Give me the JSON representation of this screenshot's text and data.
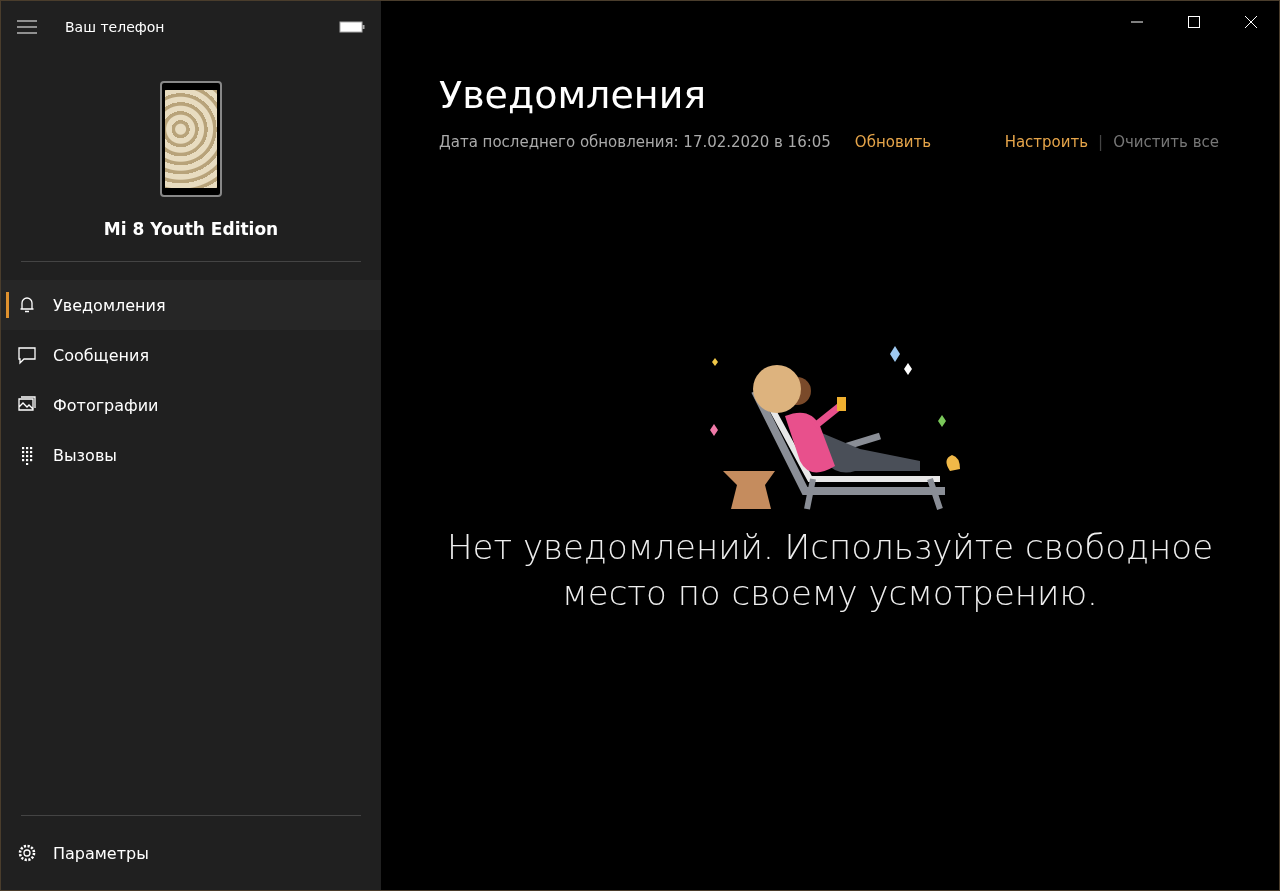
{
  "app": {
    "title": "Ваш телефон"
  },
  "device": {
    "name": "Mi 8 Youth Edition"
  },
  "nav": [
    {
      "kind": "bell",
      "label": "Уведомления",
      "selected": true
    },
    {
      "kind": "chat",
      "label": "Сообщения",
      "selected": false
    },
    {
      "kind": "photos",
      "label": "Фотографии",
      "selected": false
    },
    {
      "kind": "dialpad",
      "label": "Вызовы",
      "selected": false
    }
  ],
  "settings": {
    "label": "Параметры"
  },
  "page": {
    "title": "Уведомления",
    "updated": "Дата последнего обновления: 17.02.2020 в 16:05",
    "refresh": "Обновить",
    "customize": "Настроить",
    "separator": "|",
    "clear": "Очистить все",
    "empty_message": "Нет уведомлений. Используйте свободное место по своему усмотрению."
  }
}
